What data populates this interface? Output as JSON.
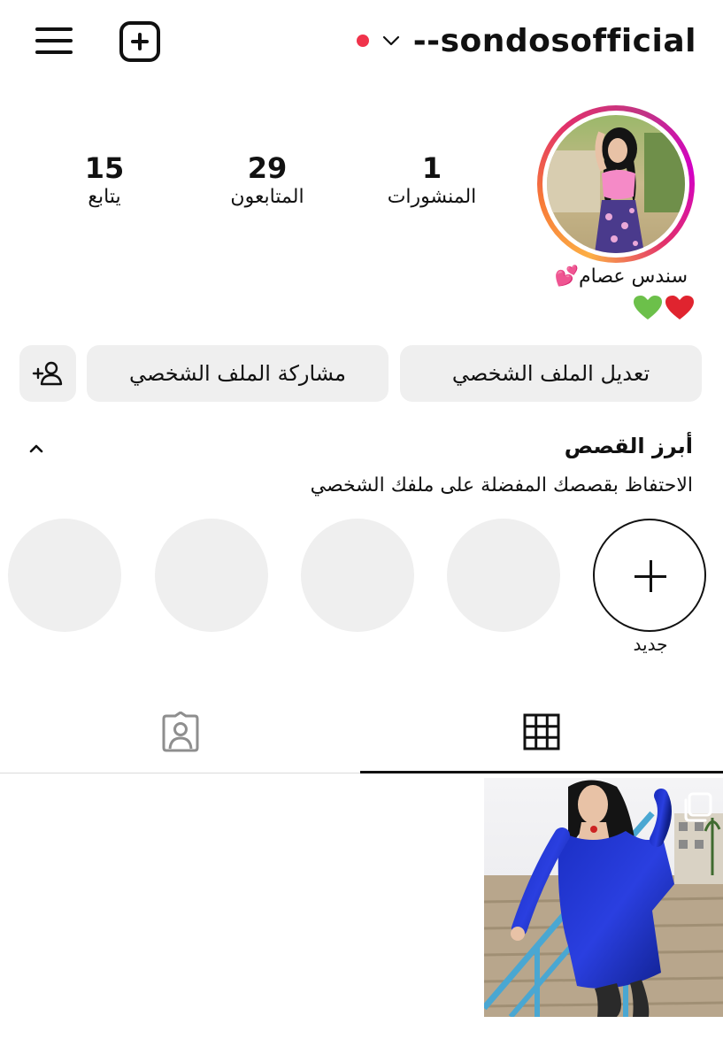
{
  "header": {
    "username": "--sondosofficial",
    "status_dot_color": "#f0334b",
    "icons": [
      "menu-icon",
      "new-post-icon",
      "chevron-down-icon"
    ]
  },
  "profile": {
    "display_name": "سندس عصام",
    "name_emoji": "💕",
    "bio_emojis": [
      "💚",
      "❤️"
    ],
    "ring_colors": [
      "#fcaf45",
      "#f77737",
      "#e1306c",
      "#c13584",
      "#d300c5"
    ]
  },
  "stats": {
    "posts": {
      "value": "1",
      "label": "المنشورات"
    },
    "followers": {
      "value": "29",
      "label": "المتابعون"
    },
    "following": {
      "value": "15",
      "label": "يتابع"
    }
  },
  "buttons": {
    "edit_profile": "تعديل الملف الشخصي",
    "share_profile": "مشاركة الملف الشخصي"
  },
  "highlights": {
    "title": "أبرز القصص",
    "subtitle": "الاحتفاظ بقصصك المفضلة على ملفك الشخصي",
    "new_label": "جديد",
    "placeholder_count": 4
  },
  "tabs": [
    {
      "name": "grid",
      "active": true,
      "icon": "grid-icon"
    },
    {
      "name": "tagged",
      "active": false,
      "icon": "tagged-person-icon"
    }
  ],
  "posts": [
    {
      "type": "carousel",
      "icon": "multiple-images-icon"
    }
  ]
}
